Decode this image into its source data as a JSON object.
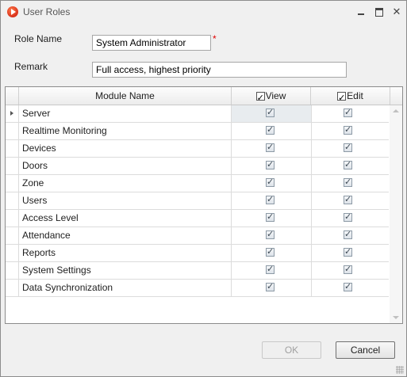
{
  "window": {
    "title": "User Roles",
    "controls": {
      "minimize": "minimize-icon",
      "maximize": "maximize-icon",
      "close": "close-icon"
    }
  },
  "form": {
    "role_name_label": "Role Name",
    "role_name_value": "System Administrator",
    "required_marker": "*",
    "remark_label": "Remark",
    "remark_value": "Full access, highest priority"
  },
  "grid": {
    "headers": {
      "module": "Module Name",
      "view": "View",
      "edit": "Edit"
    },
    "header_checks": {
      "view": true,
      "edit": true
    },
    "rows": [
      {
        "name": "Server",
        "view": true,
        "edit": true
      },
      {
        "name": "Realtime Monitoring",
        "view": true,
        "edit": true
      },
      {
        "name": "Devices",
        "view": true,
        "edit": true
      },
      {
        "name": "Doors",
        "view": true,
        "edit": true
      },
      {
        "name": "Zone",
        "view": true,
        "edit": true
      },
      {
        "name": "Users",
        "view": true,
        "edit": true
      },
      {
        "name": "Access Level",
        "view": true,
        "edit": true
      },
      {
        "name": "Attendance",
        "view": true,
        "edit": true
      },
      {
        "name": "Reports",
        "view": true,
        "edit": true
      },
      {
        "name": "System Settings",
        "view": true,
        "edit": true
      },
      {
        "name": "Data Synchronization",
        "view": true,
        "edit": true
      }
    ],
    "selected_row": 0
  },
  "buttons": {
    "ok": "OK",
    "cancel": "Cancel"
  },
  "colors": {
    "required": "#e00000",
    "selected_cell": "#e8ecef",
    "app_icon": "#d8301a"
  }
}
